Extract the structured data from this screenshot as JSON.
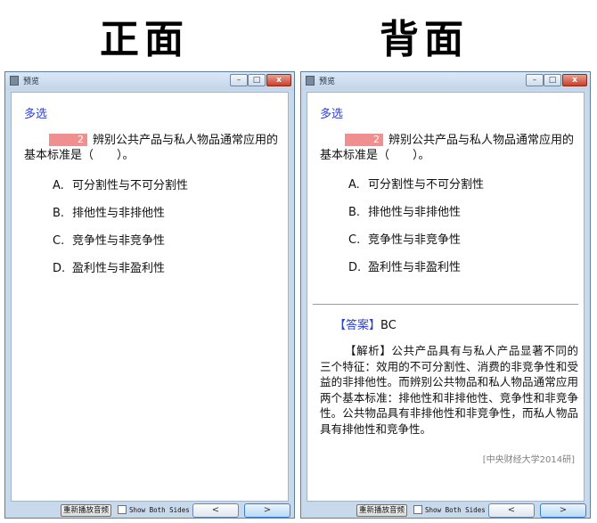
{
  "headings": {
    "front": "正面",
    "back": "背面"
  },
  "windows": [
    {
      "title": "预览",
      "question_type": "多选",
      "question_number": "2",
      "stem": "辨别公共产品与私人物品通常应用的基本标准是（　　）。",
      "options": [
        {
          "letter": "A.",
          "text": "可分割性与不可分割性"
        },
        {
          "letter": "B.",
          "text": "排他性与非排他性"
        },
        {
          "letter": "C.",
          "text": "竞争性与非竞争性"
        },
        {
          "letter": "D.",
          "text": "盈利性与非盈利性"
        }
      ],
      "replay_label": "重新播放音频",
      "show_both_label": "Show Both Sides",
      "prev_label": "<",
      "next_label": ">",
      "titlebar_buttons": {
        "minimize": "–",
        "maximize": "□",
        "close": "x"
      }
    },
    {
      "title": "预览",
      "question_type": "多选",
      "question_number": "2",
      "stem": "辨别公共产品与私人物品通常应用的基本标准是（　　）。",
      "options": [
        {
          "letter": "A.",
          "text": "可分割性与不可分割性"
        },
        {
          "letter": "B.",
          "text": "排他性与非排他性"
        },
        {
          "letter": "C.",
          "text": "竞争性与非竞争性"
        },
        {
          "letter": "D.",
          "text": "盈利性与非盈利性"
        }
      ],
      "answer_tag": "【答案】",
      "answer_value": "BC",
      "analysis_tag": "【解析】",
      "analysis_text": "公共产品具有与私人产品显著不同的三个特征：效用的不可分割性、消费的非竞争性和受益的非排他性。而辨别公共物品和私人物品通常应用两个基本标准：排他性和非排他性、竞争性和非竞争性。公共物品具有非排他性和非竞争性，而私人物品具有排他性和竞争性。",
      "source": "[中央财经大学2014研]",
      "replay_label": "重新播放音频",
      "show_both_label": "Show Both Sides",
      "prev_label": "<",
      "next_label": ">",
      "titlebar_buttons": {
        "minimize": "–",
        "maximize": "□",
        "close": "x"
      }
    }
  ],
  "colors": {
    "question_type": "#2b3fd0",
    "answer_tag": "#2b3fd0",
    "number_badge": "#f08f8f",
    "source": "#808080"
  }
}
